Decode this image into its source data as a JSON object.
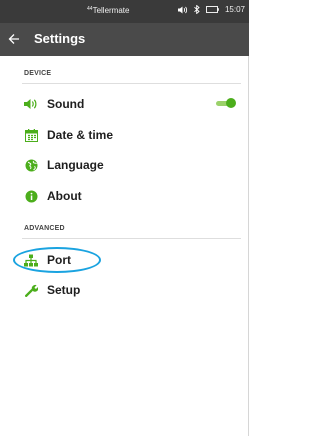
{
  "status_bar": {
    "brand_super": "44",
    "brand": "Tellermate",
    "time": "15:07",
    "icons": [
      "volume-icon",
      "bluetooth-icon",
      "battery-icon"
    ]
  },
  "app_bar": {
    "back_icon": "arrow-left-icon",
    "title": "Settings"
  },
  "sections": {
    "device": {
      "header": "DEVICE",
      "items": [
        {
          "label": "Sound",
          "icon": "speaker-icon",
          "toggle_on": true
        },
        {
          "label": "Date & time",
          "icon": "calendar-icon"
        },
        {
          "label": "Language",
          "icon": "globe-icon"
        },
        {
          "label": "About",
          "icon": "info-icon"
        }
      ]
    },
    "advanced": {
      "header": "ADVANCED",
      "items": [
        {
          "label": "Port",
          "icon": "network-icon",
          "highlighted": true
        },
        {
          "label": "Setup",
          "icon": "wrench-icon"
        }
      ]
    }
  },
  "colors": {
    "accent_green": "#4cae1c",
    "status_bar_bg": "#3a3a3a",
    "app_bar_bg": "#4a4a4a",
    "highlight_ring": "#1aa3e0"
  }
}
